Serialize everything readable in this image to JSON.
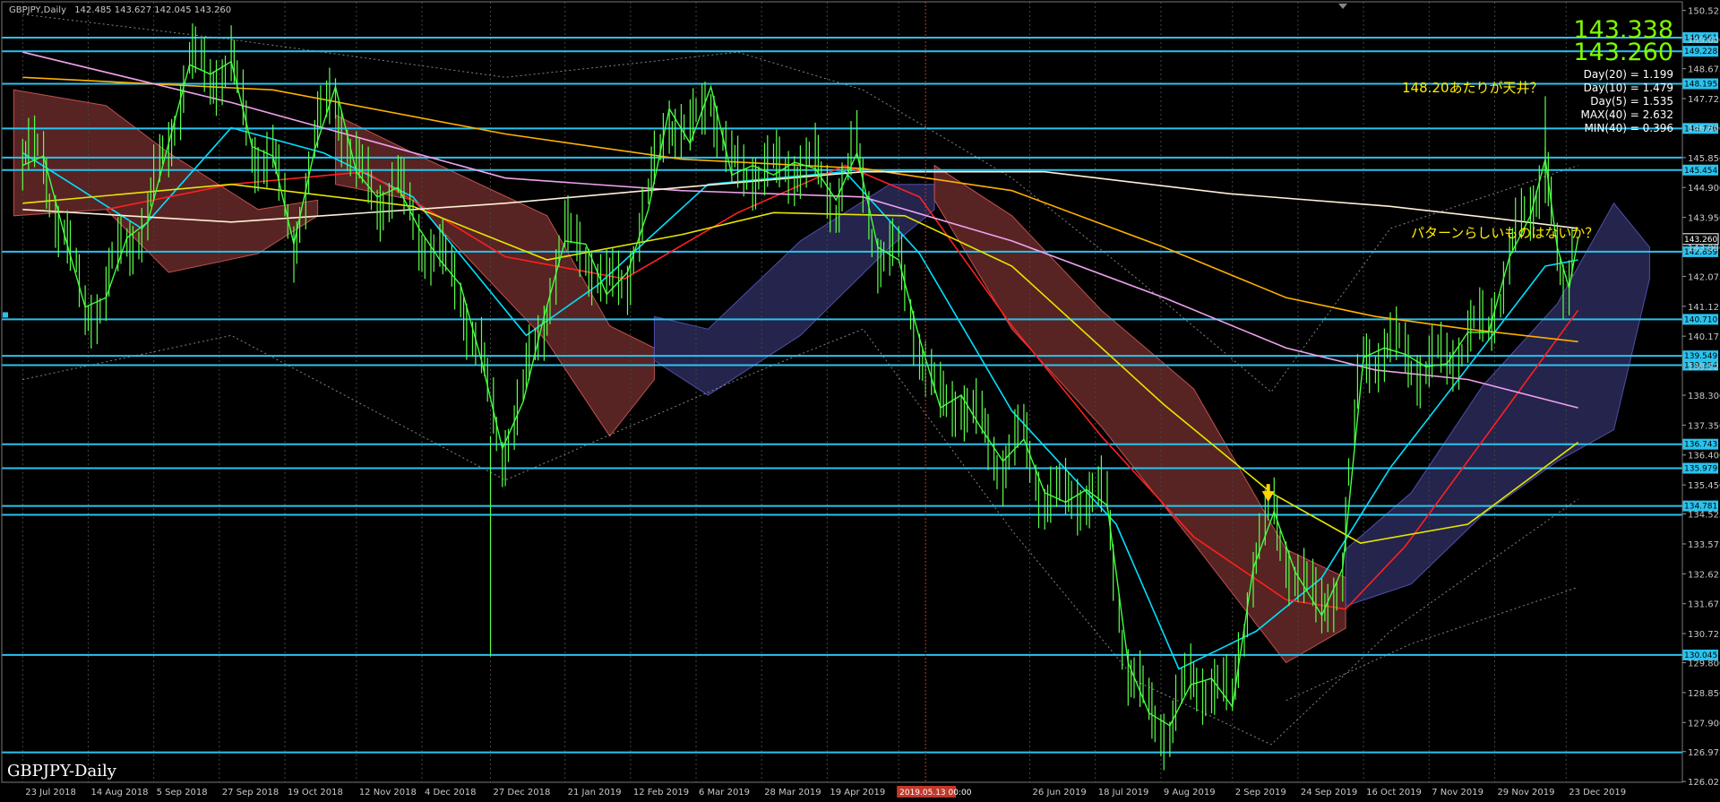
{
  "chart_data": {
    "type": "line",
    "title": "GBPJPY,Daily",
    "header_values": "142.485 143.627 142.045 143.260",
    "watermark": "GBPJPY-Daily",
    "ylim": [
      126.0,
      150.8
    ],
    "y_ticks": [
      "150.525",
      "149.600",
      "148.675",
      "147.725",
      "146.800",
      "145.850",
      "144.900",
      "143.950",
      "143.000",
      "142.075",
      "141.125",
      "140.175",
      "139.225",
      "138.300",
      "137.350",
      "136.400",
      "135.450",
      "134.525",
      "133.575",
      "132.625",
      "131.675",
      "130.725",
      "129.800",
      "128.850",
      "127.900",
      "126.975",
      "126.025"
    ],
    "x_labels": [
      "23 Jul 2018",
      "14 Aug 2018",
      "5 Sep 2018",
      "27 Sep 2018",
      "19 Oct 2018",
      "12 Nov 2018",
      "4 Dec 2018",
      "27 Dec 2018",
      "21 Jan 2019",
      "12 Feb 2019",
      "6 Mar 2019",
      "28 Mar 2019",
      "19 Apr 2019",
      "13 M",
      "2019.05.13 00:00",
      "26 Jun 2019",
      "18 Jul 2019",
      "9 Aug 2019",
      "2 Sep 2019",
      "24 Sep 2019",
      "16 Oct 2019",
      "7 Nov 2019",
      "29 Nov 2019",
      "23 Dec 2019"
    ],
    "price_big": [
      "143.338",
      "143.260"
    ],
    "stats": [
      "Day(20) = 1.199",
      "Day(10) = 1.479",
      "Day(5) = 1.535",
      "MAX(40) = 2.632",
      "MIN(40) = 0.396"
    ],
    "annotations": [
      "148.20あたりが天井？",
      "パターンらしいものはないか？"
    ],
    "horizontal_levels": [
      "149.661",
      "149.228",
      "148.195",
      "146.776",
      "145.454",
      "142.859",
      "140.710",
      "139.549",
      "139.254",
      "136.743",
      "135.979",
      "134.781",
      "130.045"
    ],
    "extra_level_lines": [
      145.85,
      134.5,
      126.95
    ],
    "current_price": "143.260",
    "price_series": [
      [
        "2018-07-23",
        145.6
      ],
      [
        "2018-07-30",
        145.9
      ],
      [
        "2018-08-06",
        143.4
      ],
      [
        "2018-08-13",
        141.1
      ],
      [
        "2018-08-20",
        141.4
      ],
      [
        "2018-08-27",
        143.3
      ],
      [
        "2018-09-03",
        143.8
      ],
      [
        "2018-09-10",
        146.3
      ],
      [
        "2018-09-17",
        148.8
      ],
      [
        "2018-09-24",
        148.5
      ],
      [
        "2018-10-01",
        148.9
      ],
      [
        "2018-10-08",
        146.2
      ],
      [
        "2018-10-15",
        145.9
      ],
      [
        "2018-10-22",
        143.1
      ],
      [
        "2018-10-29",
        146.1
      ],
      [
        "2018-11-05",
        148.1
      ],
      [
        "2018-11-12",
        145.4
      ],
      [
        "2018-11-19",
        144.6
      ],
      [
        "2018-11-26",
        144.9
      ],
      [
        "2018-12-03",
        143.6
      ],
      [
        "2018-12-10",
        142.6
      ],
      [
        "2018-12-17",
        141.8
      ],
      [
        "2018-12-24",
        139.4
      ],
      [
        "2018-12-31",
        136.6
      ],
      [
        "2019-01-07",
        138.1
      ],
      [
        "2019-01-14",
        140.8
      ],
      [
        "2019-01-21",
        143.2
      ],
      [
        "2019-01-28",
        143.1
      ],
      [
        "2019-02-04",
        141.5
      ],
      [
        "2019-02-11",
        142.2
      ],
      [
        "2019-02-18",
        144.2
      ],
      [
        "2019-02-25",
        147.4
      ],
      [
        "2019-03-04",
        146.3
      ],
      [
        "2019-03-11",
        148.1
      ],
      [
        "2019-03-18",
        145.3
      ],
      [
        "2019-03-25",
        145.6
      ],
      [
        "2019-04-01",
        145.3
      ],
      [
        "2019-04-08",
        145.7
      ],
      [
        "2019-04-15",
        145.5
      ],
      [
        "2019-04-22",
        144.5
      ],
      [
        "2019-04-29",
        146.0
      ],
      [
        "2019-05-06",
        143.0
      ],
      [
        "2019-05-13",
        142.6
      ],
      [
        "2019-05-20",
        140.1
      ],
      [
        "2019-05-27",
        137.9
      ],
      [
        "2019-06-03",
        138.3
      ],
      [
        "2019-06-10",
        137.2
      ],
      [
        "2019-06-17",
        136.2
      ],
      [
        "2019-06-24",
        136.9
      ],
      [
        "2019-07-01",
        135.2
      ],
      [
        "2019-07-08",
        134.9
      ],
      [
        "2019-07-15",
        135.3
      ],
      [
        "2019-07-22",
        134.8
      ],
      [
        "2019-07-29",
        129.8
      ],
      [
        "2019-08-05",
        128.2
      ],
      [
        "2019-08-12",
        127.8
      ],
      [
        "2019-08-19",
        129.1
      ],
      [
        "2019-08-26",
        129.3
      ],
      [
        "2019-09-02",
        128.4
      ],
      [
        "2019-09-09",
        132.8
      ],
      [
        "2019-09-16",
        134.6
      ],
      [
        "2019-09-23",
        132.7
      ],
      [
        "2019-10-02",
        131.3
      ],
      [
        "2019-10-09",
        132.8
      ],
      [
        "2019-10-16",
        139.5
      ],
      [
        "2019-10-23",
        139.8
      ],
      [
        "2019-10-30",
        139.6
      ],
      [
        "2019-11-06",
        139.2
      ],
      [
        "2019-11-13",
        139.3
      ],
      [
        "2019-11-20",
        140.3
      ],
      [
        "2019-11-27",
        140.3
      ],
      [
        "2019-12-04",
        142.7
      ],
      [
        "2019-12-11",
        144.0
      ],
      [
        "2019-12-16",
        145.8
      ],
      [
        "2019-12-20",
        143.0
      ],
      [
        "2019-12-24",
        141.7
      ],
      [
        "2019-12-27",
        143.3
      ]
    ],
    "ma_series": [
      {
        "color": "#00e0ff",
        "points": [
          [
            "2018-07-23",
            146.0
          ],
          [
            "2018-09-01",
            143.6
          ],
          [
            "2018-10-01",
            146.8
          ],
          [
            "2018-11-01",
            146.0
          ],
          [
            "2018-12-01",
            144.6
          ],
          [
            "2019-01-08",
            140.2
          ],
          [
            "2019-02-01",
            141.8
          ],
          [
            "2019-03-10",
            145.0
          ],
          [
            "2019-04-25",
            145.4
          ],
          [
            "2019-05-20",
            142.8
          ],
          [
            "2019-06-20",
            137.8
          ],
          [
            "2019-07-25",
            134.2
          ],
          [
            "2019-08-15",
            129.6
          ],
          [
            "2019-09-10",
            130.8
          ],
          [
            "2019-10-02",
            132.5
          ],
          [
            "2019-10-25",
            136.0
          ],
          [
            "2019-11-25",
            139.8
          ],
          [
            "2019-12-16",
            142.4
          ],
          [
            "2019-12-27",
            142.6
          ]
        ]
      },
      {
        "color": "#ff2020",
        "points": [
          [
            "2018-08-20",
            144.2
          ],
          [
            "2018-10-01",
            145.0
          ],
          [
            "2018-11-15",
            145.4
          ],
          [
            "2019-01-01",
            142.7
          ],
          [
            "2019-02-10",
            142.0
          ],
          [
            "2019-03-20",
            144.1
          ],
          [
            "2019-04-25",
            145.6
          ],
          [
            "2019-05-20",
            144.6
          ],
          [
            "2019-06-20",
            140.5
          ],
          [
            "2019-07-20",
            137.0
          ],
          [
            "2019-08-20",
            133.8
          ],
          [
            "2019-09-20",
            131.8
          ],
          [
            "2019-10-10",
            131.5
          ],
          [
            "2019-10-30",
            133.5
          ],
          [
            "2019-11-30",
            137.5
          ],
          [
            "2019-12-27",
            141.0
          ]
        ]
      },
      {
        "color": "#e6e600",
        "points": [
          [
            "2018-07-23",
            144.4
          ],
          [
            "2018-10-01",
            145.0
          ],
          [
            "2018-12-01",
            144.3
          ],
          [
            "2019-01-15",
            142.6
          ],
          [
            "2019-03-01",
            143.4
          ],
          [
            "2019-04-01",
            144.1
          ],
          [
            "2019-05-15",
            144.0
          ],
          [
            "2019-06-20",
            142.4
          ],
          [
            "2019-08-10",
            138.0
          ],
          [
            "2019-09-15",
            135.2
          ],
          [
            "2019-10-15",
            133.6
          ],
          [
            "2019-11-20",
            134.2
          ],
          [
            "2019-12-27",
            136.8
          ]
        ]
      },
      {
        "color": "#ffb000",
        "points": [
          [
            "2018-07-23",
            148.4
          ],
          [
            "2018-10-15",
            148.0
          ],
          [
            "2019-01-01",
            146.6
          ],
          [
            "2019-03-01",
            145.8
          ],
          [
            "2019-05-01",
            145.5
          ],
          [
            "2019-06-20",
            144.8
          ],
          [
            "2019-08-10",
            143.0
          ],
          [
            "2019-09-20",
            141.4
          ],
          [
            "2019-10-20",
            140.8
          ],
          [
            "2019-11-20",
            140.4
          ],
          [
            "2019-12-27",
            140.0
          ]
        ]
      },
      {
        "color": "#f0a0f0",
        "points": [
          [
            "2018-07-23",
            149.2
          ],
          [
            "2018-10-01",
            147.6
          ],
          [
            "2019-01-01",
            145.2
          ],
          [
            "2019-03-01",
            144.8
          ],
          [
            "2019-05-01",
            144.6
          ],
          [
            "2019-06-20",
            143.2
          ],
          [
            "2019-08-10",
            141.4
          ],
          [
            "2019-09-20",
            139.8
          ],
          [
            "2019-10-20",
            139.1
          ],
          [
            "2019-11-20",
            138.8
          ],
          [
            "2019-12-27",
            137.9
          ]
        ]
      },
      {
        "color": "#fff0d8",
        "points": [
          [
            "2018-07-23",
            144.2
          ],
          [
            "2018-10-01",
            143.8
          ],
          [
            "2019-01-01",
            144.4
          ],
          [
            "2019-03-01",
            144.9
          ],
          [
            "2019-05-01",
            145.4
          ],
          [
            "2019-07-01",
            145.4
          ],
          [
            "2019-09-01",
            144.7
          ],
          [
            "2019-10-25",
            144.3
          ],
          [
            "2019-12-01",
            143.9
          ],
          [
            "2019-12-27",
            143.6
          ]
        ]
      }
    ]
  }
}
